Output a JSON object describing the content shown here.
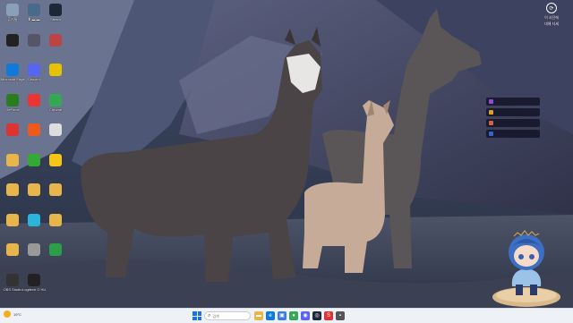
{
  "desktop": {
    "icons": [
      {
        "label": "휴지통",
        "icon": "recycle-bin-icon",
        "color": "#8aa0b8"
      },
      {
        "label": "Ⅲ ▬ ▬",
        "icon": "monitor-icon",
        "color": "#4a6a8a"
      },
      {
        "label": "Steam",
        "icon": "steam-icon",
        "color": "#1b2838"
      },
      {
        "label": "",
        "icon": "app-icon",
        "color": "#222"
      },
      {
        "label": "",
        "icon": "app-icon",
        "color": "#556"
      },
      {
        "label": "",
        "icon": "app-icon",
        "color": "#b44"
      },
      {
        "label": "Microsoft Edge",
        "icon": "edge-icon",
        "color": "#0f7ad8"
      },
      {
        "label": "Discord",
        "icon": "discord-icon",
        "color": "#5865f2"
      },
      {
        "label": "",
        "icon": "app-icon",
        "color": "#e6c200"
      },
      {
        "label": "GeForce",
        "icon": "nvidia-icon",
        "color": "#2a7d1e"
      },
      {
        "label": "",
        "icon": "app-icon",
        "color": "#e33"
      },
      {
        "label": "Chrome",
        "icon": "chrome-icon",
        "color": "#34a853"
      },
      {
        "label": "",
        "icon": "app-icon",
        "color": "#d33"
      },
      {
        "label": "",
        "icon": "app-icon",
        "color": "#ee5a1c"
      },
      {
        "label": "",
        "icon": "app-icon",
        "color": "#ddd"
      },
      {
        "label": "",
        "icon": "folder-icon",
        "color": "#e8b54a"
      },
      {
        "label": "",
        "icon": "app-icon",
        "color": "#3a3"
      },
      {
        "label": "",
        "icon": "app-icon",
        "color": "#f5c518"
      },
      {
        "label": "",
        "icon": "folder-icon",
        "color": "#e8b54a"
      },
      {
        "label": "",
        "icon": "folder-icon",
        "color": "#e8b54a"
      },
      {
        "label": "",
        "icon": "folder-icon",
        "color": "#e8b54a"
      },
      {
        "label": "",
        "icon": "folder-icon",
        "color": "#e8b54a"
      },
      {
        "label": "",
        "icon": "app-icon",
        "color": "#2bb3d9"
      },
      {
        "label": "",
        "icon": "folder-icon",
        "color": "#e8b54a"
      },
      {
        "label": "",
        "icon": "folder-icon",
        "color": "#e8b54a"
      },
      {
        "label": "",
        "icon": "app-icon",
        "color": "#999"
      },
      {
        "label": "",
        "icon": "app-icon",
        "color": "#2d9d4a"
      },
      {
        "label": "OBS Studio",
        "icon": "obs-icon",
        "color": "#333"
      },
      {
        "label": "Logitech G HUB",
        "icon": "logitech-icon",
        "color": "#222"
      }
    ]
  },
  "widget": {
    "icon": "clock-icon",
    "line1": "이 사진에",
    "line2": "대해 자세"
  },
  "overlay": {
    "rows": [
      {
        "text": "",
        "color": "#8a4fd6"
      },
      {
        "text": "",
        "color": "#e0a020"
      },
      {
        "text": "",
        "color": "#c64"
      },
      {
        "text": "",
        "color": "#36c"
      }
    ]
  },
  "taskbar": {
    "weather": {
      "temp": "19°C",
      "desc": "",
      "icon": "sun-icon"
    },
    "search_placeholder": "검색",
    "apps": [
      {
        "name": "explorer-icon",
        "color": "#e8b54a",
        "glyph": "▬"
      },
      {
        "name": "edge-icon",
        "color": "#0f7ad8",
        "glyph": "e"
      },
      {
        "name": "store-icon",
        "color": "#3c7ce0",
        "glyph": "▣"
      },
      {
        "name": "chrome-icon",
        "color": "#34a853",
        "glyph": "●"
      },
      {
        "name": "discord-icon",
        "color": "#5865f2",
        "glyph": "◉"
      },
      {
        "name": "steam-icon",
        "color": "#1b2838",
        "glyph": "◎"
      },
      {
        "name": "app-icon",
        "color": "#d33",
        "glyph": "S"
      },
      {
        "name": "app-icon",
        "color": "#555",
        "glyph": "▪"
      }
    ],
    "tray": {
      "line1": "",
      "line2": ""
    }
  },
  "colors": {
    "taskbar_bg": "#eef1f6",
    "accent": "#1a73e8"
  }
}
